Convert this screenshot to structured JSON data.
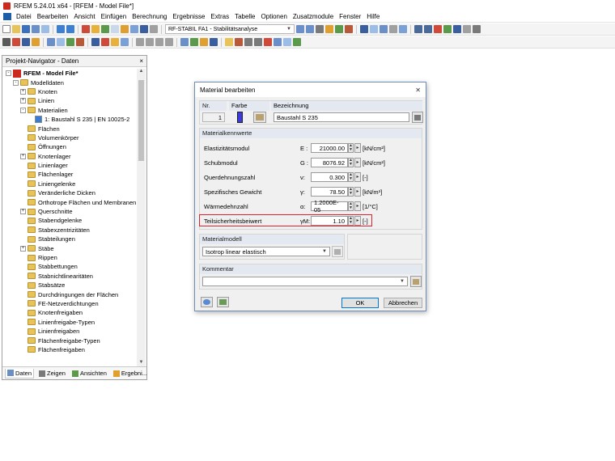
{
  "window": {
    "title": "RFEM 5.24.01 x64 - [RFEM - Model File*]"
  },
  "menu": [
    "Datei",
    "Bearbeiten",
    "Ansicht",
    "Einfügen",
    "Berechnung",
    "Ergebnisse",
    "Extras",
    "Tabelle",
    "Optionen",
    "Zusatzmodule",
    "Fenster",
    "Hilfe"
  ],
  "toolbar": {
    "case_combo": "RF-STABIL FA1 - Stabilitätsanalyse"
  },
  "navigator": {
    "title": "Projekt-Navigator - Daten",
    "close_glyph": "×",
    "root": "RFEM - Model File*",
    "items": [
      {
        "label": "Modelldaten",
        "level": 1,
        "exp": "-",
        "icon": "folder"
      },
      {
        "label": "Knoten",
        "level": 2,
        "exp": "+",
        "icon": "folder"
      },
      {
        "label": "Linien",
        "level": 2,
        "exp": "+",
        "icon": "folder"
      },
      {
        "label": "Materialien",
        "level": 2,
        "exp": "-",
        "icon": "folder"
      },
      {
        "label": "1: Baustahl S 235 | EN 10025-2",
        "level": 3,
        "exp": "",
        "icon": "material"
      },
      {
        "label": "Flächen",
        "level": 2,
        "exp": "",
        "icon": "folder"
      },
      {
        "label": "Volumenkörper",
        "level": 2,
        "exp": "",
        "icon": "folder"
      },
      {
        "label": "Öffnungen",
        "level": 2,
        "exp": "",
        "icon": "folder"
      },
      {
        "label": "Knotenlager",
        "level": 2,
        "exp": "+",
        "icon": "folder"
      },
      {
        "label": "Linienlager",
        "level": 2,
        "exp": "",
        "icon": "folder"
      },
      {
        "label": "Flächenlager",
        "level": 2,
        "exp": "",
        "icon": "folder"
      },
      {
        "label": "Liniengelenke",
        "level": 2,
        "exp": "",
        "icon": "folder"
      },
      {
        "label": "Veränderliche Dicken",
        "level": 2,
        "exp": "",
        "icon": "folder"
      },
      {
        "label": "Orthotrope Flächen und Membranen",
        "level": 2,
        "exp": "",
        "icon": "folder"
      },
      {
        "label": "Querschnitte",
        "level": 2,
        "exp": "+",
        "icon": "folder"
      },
      {
        "label": "Stabendgelenke",
        "level": 2,
        "exp": "",
        "icon": "folder"
      },
      {
        "label": "Stabexzentrizitäten",
        "level": 2,
        "exp": "",
        "icon": "folder"
      },
      {
        "label": "Stabteilungen",
        "level": 2,
        "exp": "",
        "icon": "folder"
      },
      {
        "label": "Stäbe",
        "level": 2,
        "exp": "+",
        "icon": "folder"
      },
      {
        "label": "Rippen",
        "level": 2,
        "exp": "",
        "icon": "folder"
      },
      {
        "label": "Stabbettungen",
        "level": 2,
        "exp": "",
        "icon": "folder"
      },
      {
        "label": "Stabnichtlinearitäten",
        "level": 2,
        "exp": "",
        "icon": "folder"
      },
      {
        "label": "Stabsätze",
        "level": 2,
        "exp": "",
        "icon": "folder"
      },
      {
        "label": "Durchdringungen der Flächen",
        "level": 2,
        "exp": "",
        "icon": "folder"
      },
      {
        "label": "FE-Netzverdichtungen",
        "level": 2,
        "exp": "",
        "icon": "folder"
      },
      {
        "label": "Knotenfreigaben",
        "level": 2,
        "exp": "",
        "icon": "folder"
      },
      {
        "label": "Linienfreigabe-Typen",
        "level": 2,
        "exp": "",
        "icon": "folder"
      },
      {
        "label": "Linienfreigaben",
        "level": 2,
        "exp": "",
        "icon": "folder"
      },
      {
        "label": "Flächenfreigabe-Typen",
        "level": 2,
        "exp": "",
        "icon": "folder"
      },
      {
        "label": "Flächenfreigaben",
        "level": 2,
        "exp": "",
        "icon": "folder"
      }
    ],
    "tabs": [
      "Daten",
      "Zeigen",
      "Ansichten",
      "Ergebni..."
    ]
  },
  "dialog": {
    "title": "Material bearbeiten",
    "close_glyph": "✕",
    "nr_label": "Nr.",
    "nr_value": "1",
    "farbe_label": "Farbe",
    "bezeichnung_label": "Bezeichnung",
    "bezeichnung_value": "Baustahl S 235",
    "kennwerte_title": "Materialkennwerte",
    "properties": [
      {
        "label": "Elastizitätsmodul",
        "symbol": "E :",
        "value": "21000.00",
        "unit": "[kN/cm²]"
      },
      {
        "label": "Schubmodul",
        "symbol": "G :",
        "value": "8076.92",
        "unit": "[kN/cm²]"
      },
      {
        "label": "Querdehnungszahl",
        "symbol": "ν:",
        "value": "0.300",
        "unit": "[-]"
      },
      {
        "label": "Spezifisches Gewicht",
        "symbol": "γ:",
        "value": "78.50",
        "unit": "[kN/m³]"
      },
      {
        "label": "Wärmedehnzahl",
        "symbol": "α:",
        "value": "1.2000E-05",
        "unit": "[1/°C]"
      },
      {
        "label": "Teilsicherheitsbeiwert",
        "symbol": "γM:",
        "value": "1.10",
        "unit": "[-]"
      }
    ],
    "modell_title": "Materialmodell",
    "modell_value": "Isotrop linear elastisch",
    "kommentar_title": "Kommentar",
    "kommentar_value": "",
    "ok_label": "OK",
    "cancel_label": "Abbrechen",
    "highlight_color": "#d9232f"
  }
}
